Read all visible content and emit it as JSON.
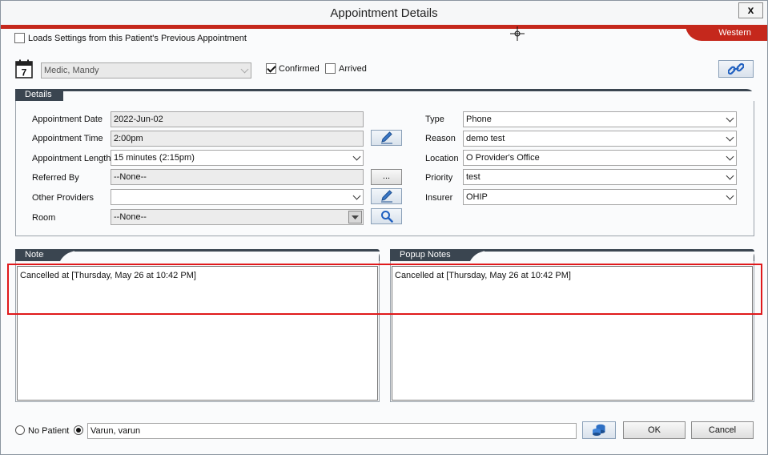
{
  "window": {
    "title": "Appointment Details",
    "close_label": "x"
  },
  "header": {
    "load_settings_label": "Loads Settings from this Patient's Previous Appointment",
    "region_tab": "Western"
  },
  "provider": {
    "selected": "Medic, Mandy",
    "confirmed_label": "Confirmed",
    "confirmed_checked": true,
    "arrived_label": "Arrived",
    "arrived_checked": false
  },
  "details": {
    "section_label": "Details",
    "appointment_date_label": "Appointment Date",
    "appointment_date_value": "2022-Jun-02",
    "appointment_time_label": "Appointment Time",
    "appointment_time_value": "2:00pm",
    "appointment_length_label": "Appointment Length",
    "appointment_length_value": "15 minutes (2:15pm)",
    "referred_by_label": "Referred By",
    "referred_by_value": "--None--",
    "referred_browse_label": "...",
    "other_providers_label": "Other Providers",
    "other_providers_value": "",
    "room_label": "Room",
    "room_value": "--None--",
    "type_label": "Type",
    "type_value": "Phone",
    "reason_label": "Reason",
    "reason_value": "demo test",
    "location_label": "Location",
    "location_value": "O Provider's Office",
    "priority_label": "Priority",
    "priority_value": "test",
    "insurer_label": "Insurer",
    "insurer_value": "OHIP"
  },
  "notes": {
    "section_label": "Notes",
    "text": "Cancelled at [Thursday, May 26 at 10:42 PM]"
  },
  "popup_notes": {
    "section_label": "Popup Notes",
    "text": "Cancelled at [Thursday, May 26 at 10:42 PM]"
  },
  "footer": {
    "no_patient_label": "No Patient",
    "no_patient_selected": false,
    "patient_selected": true,
    "patient_value": "Varun, varun",
    "ok_label": "OK",
    "cancel_label": "Cancel"
  },
  "calendar_icon_day": "7",
  "colors": {
    "accent_red": "#c5281c",
    "section_header": "#3a4550",
    "highlight": "#e0191b"
  }
}
